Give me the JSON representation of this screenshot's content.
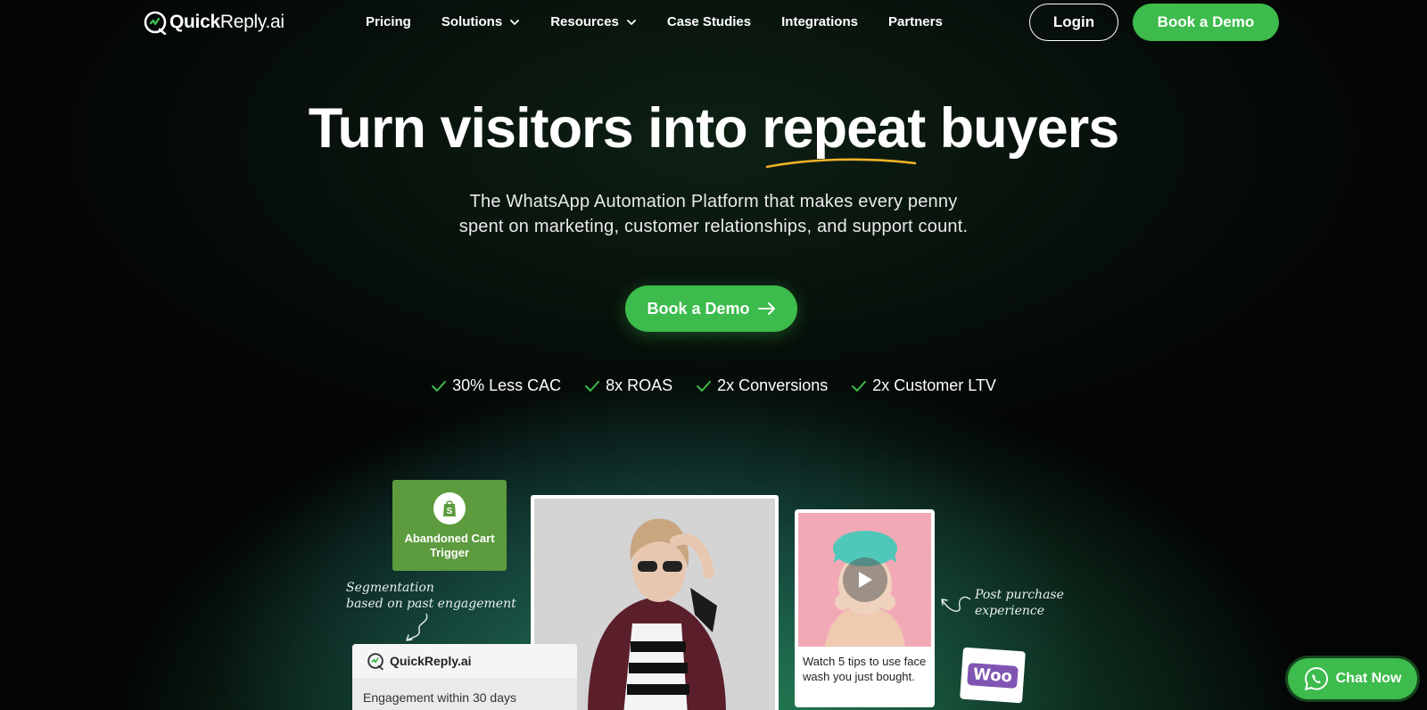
{
  "nav": {
    "logo_bold": "Quick",
    "logo_rest": "Reply.ai",
    "links": [
      "Pricing",
      "Solutions",
      "Resources",
      "Case Studies",
      "Integrations",
      "Partners"
    ],
    "login_label": "Login",
    "demo_label": "Book a Demo"
  },
  "hero": {
    "title_part1": "Turn visitors into ",
    "title_highlight": "repeat",
    "title_part2": " buyers",
    "subtitle_line1": "The WhatsApp Automation Platform that makes every penny",
    "subtitle_line2": "spent on marketing, customer relationships, and support count.",
    "cta_label": "Book a Demo",
    "stats": [
      "30% Less CAC",
      "8x ROAS",
      "2x Conversions",
      "2x Customer LTV"
    ]
  },
  "showcase": {
    "trigger_line1": "Abandoned Cart",
    "trigger_line2": "Trigger",
    "seg_note_line1": "Segmentation",
    "seg_note_line2": "based on past engagement",
    "post_note_line1": "Post purchase",
    "post_note_line2": "experience",
    "video_caption": "Watch 5 tips to use face wash you just bought.",
    "woo_label": "Woo",
    "qr_card_title": "QuickReply.ai",
    "qr_card_body": "Engagement within 30 days"
  },
  "chat_widget": {
    "label": "Chat Now"
  },
  "colors": {
    "brand_green": "#3dbb4c",
    "trigger_green": "#5c9b3e",
    "underline_yellow": "#f0b429",
    "woo_purple": "#7f54b3"
  }
}
